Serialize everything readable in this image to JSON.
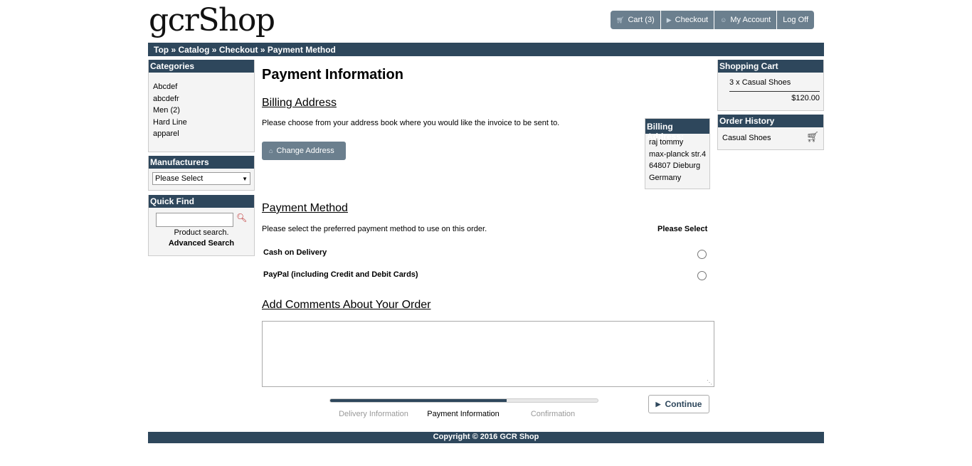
{
  "logo": "gcrShop",
  "header_nav": [
    {
      "label": "Cart (3)",
      "icon": "cart-icon"
    },
    {
      "label": "Checkout",
      "icon": "triangle-right-icon"
    },
    {
      "label": "My Account",
      "icon": "person-icon"
    },
    {
      "label": "Log Off",
      "icon": ""
    }
  ],
  "breadcrumb": [
    "Top",
    "Catalog",
    "Checkout",
    "Payment Method"
  ],
  "breadcrumb_sep": " » ",
  "left": {
    "categories": {
      "title": "Categories",
      "items": [
        "Abcdef",
        "abcdefr",
        "Men (2)",
        "Hard Line",
        "apparel"
      ]
    },
    "manufacturers": {
      "title": "Manufacturers",
      "selected": "Please Select"
    },
    "quick_find": {
      "title": "Quick Find",
      "hint": "Product search.",
      "advanced": "Advanced Search"
    }
  },
  "main": {
    "title": "Payment Information",
    "billing": {
      "heading": "Billing Address",
      "text": "Please choose from your address book where you would like the invoice to be sent to.",
      "change_button": "Change Address",
      "box_title": "Billing Address:",
      "address": [
        "raj tommy",
        "max-planck str.4",
        "64807 Dieburg",
        "Germany"
      ]
    },
    "payment": {
      "heading": "Payment Method",
      "text": "Please select the preferred payment method to use on this order.",
      "select_label": "Please Select",
      "methods": [
        "Cash on Delivery",
        "PayPal (including Credit and Debit Cards)"
      ]
    },
    "comments": {
      "heading": "Add Comments About Your Order"
    },
    "progress": {
      "fraction": 0.66,
      "steps": [
        "Delivery Information",
        "Payment Information",
        "Confirmation"
      ],
      "active": 1
    },
    "continue_label": "Continue"
  },
  "right": {
    "cart": {
      "title": "Shopping Cart",
      "item": "3 x Casual Shoes",
      "total": "$120.00"
    },
    "history": {
      "title": "Order History",
      "item": "Casual Shoes"
    }
  },
  "footer": "Copyright © 2016 GCR Shop",
  "colors": {
    "brand": "#2e475c",
    "button": "#6b7f8e"
  }
}
